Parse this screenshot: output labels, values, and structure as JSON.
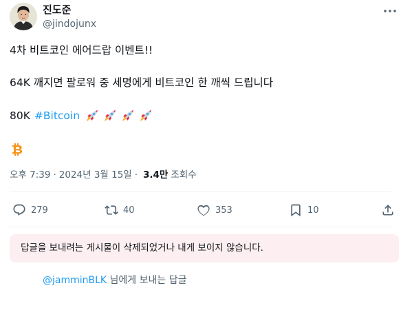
{
  "author": {
    "name": "진도준",
    "handle": "@jindojunx"
  },
  "tweet": {
    "line1": "4차 비트코인 에어드랍 이벤트!!",
    "line2": "64K 깨지면 팔로워 중 세명에게 비트코인 한 깨씩 드립니다",
    "line3_prefix": "80K",
    "hashtag": "#Bitcoin",
    "rocket_emoji_count": 4,
    "trailing_emoji": "bitcoin-emoji"
  },
  "meta": {
    "time": "오후 7:39",
    "separator": "·",
    "date": "2024년 3월 15일",
    "views_count": "3.4만",
    "views_label": "조회수"
  },
  "actions": {
    "replies": "279",
    "reposts": "40",
    "likes": "353",
    "bookmarks": "10"
  },
  "notice": {
    "text": "답글을 보내려는 게시물이 삭제되었거나 내게 보이지 않습니다."
  },
  "replying_to": {
    "mention": "@jamminBLK",
    "suffix": " 님에게 보내는 답글"
  },
  "colors": {
    "accent": "#1d9bf0",
    "secondary_text": "#536471",
    "notice_bg": "#fdeff1",
    "bitcoin": "#f7931a"
  }
}
